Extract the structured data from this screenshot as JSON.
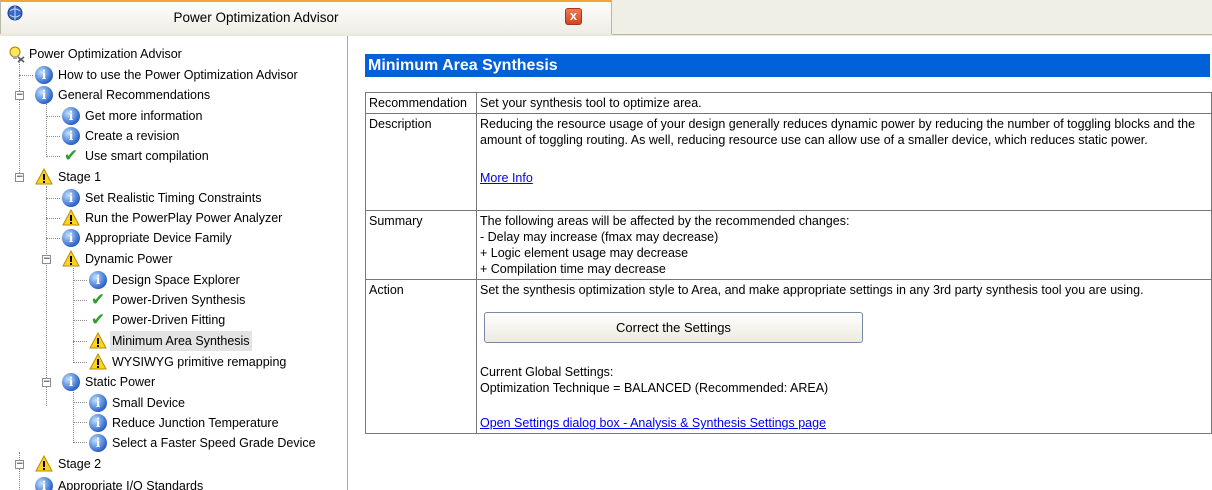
{
  "tab": {
    "title": "Power Optimization Advisor",
    "close_label": "x"
  },
  "tree": {
    "nodes": [
      {
        "label": "Power Optimization Advisor"
      },
      {
        "label": "How to use the Power Optimization Advisor"
      },
      {
        "label": "General Recommendations"
      },
      {
        "label": "Get more information"
      },
      {
        "label": "Create a revision"
      },
      {
        "label": "Use smart compilation"
      },
      {
        "label": "Stage 1"
      },
      {
        "label": "Set Realistic Timing Constraints"
      },
      {
        "label": "Run the PowerPlay Power Analyzer"
      },
      {
        "label": "Appropriate Device Family"
      },
      {
        "label": "Dynamic Power"
      },
      {
        "label": "Design Space Explorer"
      },
      {
        "label": "Power-Driven Synthesis"
      },
      {
        "label": "Power-Driven Fitting"
      },
      {
        "label": "Minimum Area Synthesis"
      },
      {
        "label": "WYSIWYG primitive remapping"
      },
      {
        "label": "Static Power"
      },
      {
        "label": "Small Device"
      },
      {
        "label": "Reduce Junction Temperature"
      },
      {
        "label": "Select a Faster Speed Grade Device"
      },
      {
        "label": "Stage 2"
      },
      {
        "label": "Appropriate I/O Standards"
      }
    ]
  },
  "main": {
    "title": "Minimum Area Synthesis",
    "recommendation": {
      "key": "Recommendation",
      "text": "Set your synthesis tool to optimize area."
    },
    "description": {
      "key": "Description",
      "text": "Reducing the resource usage of your design generally reduces dynamic power by reducing the number of toggling blocks and the amount of toggling routing. As well, reducing resource use can allow use of a smaller device, which reduces static power.",
      "link": "More Info"
    },
    "summary": {
      "key": "Summary",
      "lines": [
        "The following areas will be affected by the recommended changes:",
        "- Delay may increase (fmax may decrease)",
        "+ Logic element usage may decrease",
        "+ Compilation time may decrease"
      ]
    },
    "action": {
      "key": "Action",
      "text": "Set the synthesis optimization style to Area, and make appropriate settings in any 3rd party synthesis tool you are using.",
      "button": "Correct the Settings",
      "settings_heading": "Current Global Settings:",
      "settings_line": "Optimization Technique = BALANCED (Recommended: AREA)",
      "link": "Open Settings dialog box - Analysis & Synthesis Settings page"
    }
  }
}
